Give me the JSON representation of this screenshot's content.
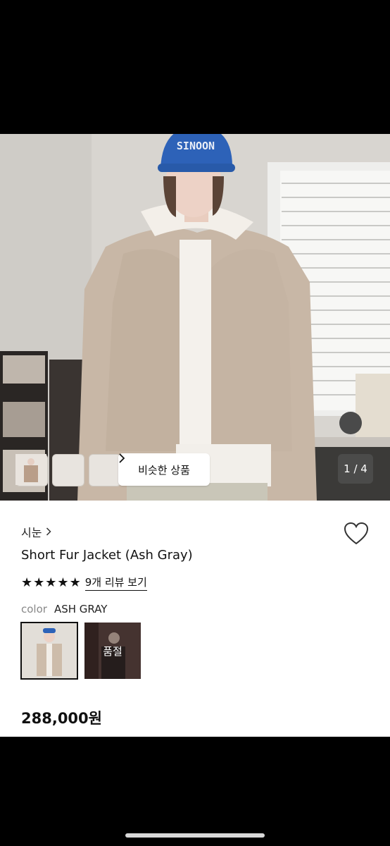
{
  "gallery": {
    "cap_text": "SINOON",
    "similar_label": "비슷한 상품",
    "counter": "1 / 4"
  },
  "product": {
    "brand": "시눈",
    "title": "Short Fur Jacket (Ash Gray)",
    "rating": 5,
    "review_link": "9개 리뷰 보기",
    "color_label": "color",
    "color_value": "ASH GRAY",
    "soldout_label": "품절",
    "price": "288,000원"
  },
  "icons": {
    "brand_chevron": "chevron-right-icon",
    "similar_chevron": "chevron-right-icon",
    "wishlist": "heart-outline-icon",
    "star": "star-filled-icon"
  }
}
